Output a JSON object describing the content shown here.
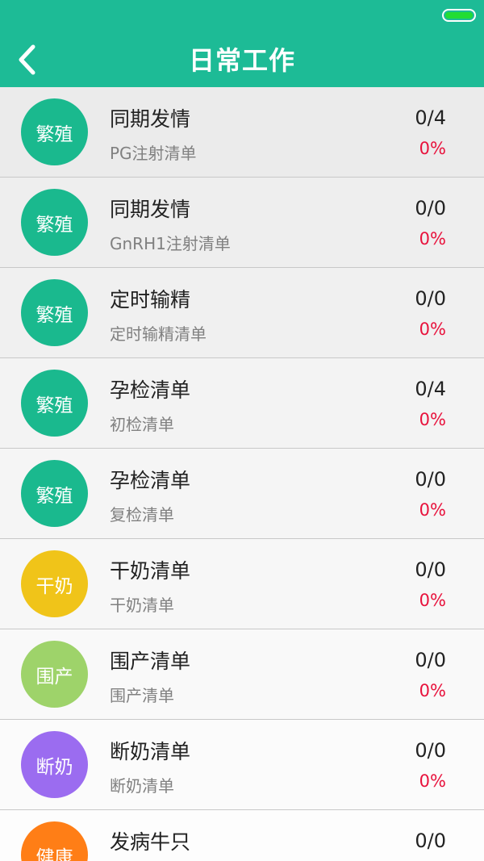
{
  "header": {
    "title": "日常工作",
    "back_icon": "chevron-left-icon",
    "battery_icon": "battery-icon"
  },
  "colors": {
    "header_bg": "#1dbb96",
    "breeding": "#1ab98e",
    "dry": "#f0c419",
    "perinatal": "#9ed36a",
    "weaning": "#9b6cf0",
    "health": "#ff7e16",
    "percent": "#e8123c"
  },
  "rows": [
    {
      "badge": "繁殖",
      "color": "#1ab98e",
      "title": "同期发情",
      "subtitle": "PG注射清单",
      "count": "0/4",
      "percent": "0%",
      "bg": "#ebebeb"
    },
    {
      "badge": "繁殖",
      "color": "#1ab98e",
      "title": "同期发情",
      "subtitle": "GnRH1注射清单",
      "count": "0/0",
      "percent": "0%",
      "bg": "#eeeeee"
    },
    {
      "badge": "繁殖",
      "color": "#1ab98e",
      "title": "定时输精",
      "subtitle": "定时输精清单",
      "count": "0/0",
      "percent": "0%",
      "bg": "#f0f0f0"
    },
    {
      "badge": "繁殖",
      "color": "#1ab98e",
      "title": "孕检清单",
      "subtitle": "初检清单",
      "count": "0/4",
      "percent": "0%",
      "bg": "#f3f3f3"
    },
    {
      "badge": "繁殖",
      "color": "#1ab98e",
      "title": "孕检清单",
      "subtitle": "复检清单",
      "count": "0/0",
      "percent": "0%",
      "bg": "#f5f5f5"
    },
    {
      "badge": "干奶",
      "color": "#f0c419",
      "title": "干奶清单",
      "subtitle": "干奶清单",
      "count": "0/0",
      "percent": "0%",
      "bg": "#f7f7f7"
    },
    {
      "badge": "围产",
      "color": "#9ed36a",
      "title": "围产清单",
      "subtitle": "围产清单",
      "count": "0/0",
      "percent": "0%",
      "bg": "#f9f9f9"
    },
    {
      "badge": "断奶",
      "color": "#9b6cf0",
      "title": "断奶清单",
      "subtitle": "断奶清单",
      "count": "0/0",
      "percent": "0%",
      "bg": "#fbfbfb"
    },
    {
      "badge": "健康",
      "color": "#ff7e16",
      "title": "发病牛只",
      "subtitle": "",
      "count": "0/0",
      "percent": "",
      "bg": "#fdfdfd"
    }
  ]
}
